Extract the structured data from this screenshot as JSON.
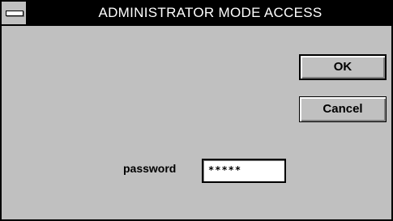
{
  "window": {
    "title": "ADMINISTRATOR MODE ACCESS",
    "system_menu_icon": "system-menu-icon"
  },
  "buttons": {
    "ok_label": "OK",
    "cancel_label": "Cancel"
  },
  "password": {
    "label": "password",
    "value": "*****"
  }
}
